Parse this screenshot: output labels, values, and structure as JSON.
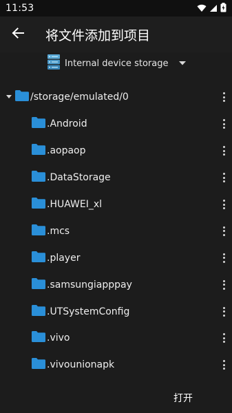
{
  "status_bar": {
    "time": "11:53",
    "icons": [
      "wifi-icon",
      "signal-icon",
      "battery-charging-icon"
    ]
  },
  "app_bar": {
    "back_icon": "arrow-left-icon",
    "title": "将文件添加到项目"
  },
  "storage": {
    "icon": "storage-server-icon",
    "label": "Internal device storage",
    "caret_icon": "caret-down-icon"
  },
  "tree": {
    "root": {
      "label": "/storage/emulated/0",
      "expanded": true
    },
    "children": [
      {
        "label": ".Android"
      },
      {
        "label": ".aopaop"
      },
      {
        "label": ".DataStorage"
      },
      {
        "label": ".HUAWEI_xl"
      },
      {
        "label": ".mcs"
      },
      {
        "label": ".player"
      },
      {
        "label": ".samsungiapppay"
      },
      {
        "label": ".UTSystemConfig"
      },
      {
        "label": ".vivo"
      },
      {
        "label": ".vivounionapk"
      }
    ]
  },
  "footer": {
    "open_label": "打开"
  },
  "colors": {
    "background": "#1c1c1c",
    "app_bar": "#1e1e1e",
    "status_bar": "#101010",
    "folder": "#2a8fd8",
    "text": "#eeeeee"
  }
}
